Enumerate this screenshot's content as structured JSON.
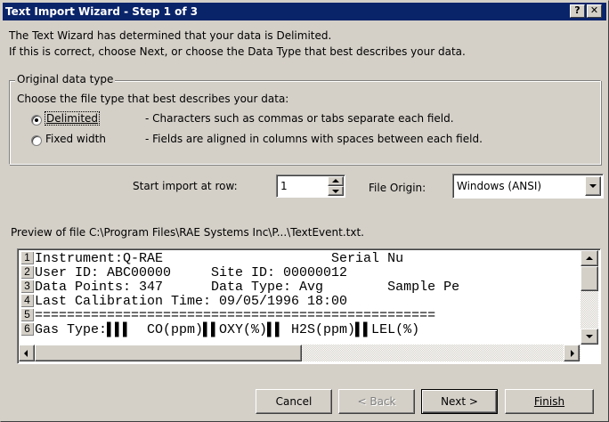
{
  "window": {
    "title": "Text Import Wizard - Step 1 of 3",
    "help_button": "?",
    "close_button": "✕"
  },
  "intro": {
    "line1": "The Text Wizard has determined that your data is Delimited.",
    "line2": "If this is correct, choose Next, or choose the Data Type that best describes your data."
  },
  "original_type": {
    "group_label": "Original data type",
    "prompt": "Choose the file type that best describes your data:",
    "options": [
      {
        "label": "Delimited",
        "description": "- Characters such as commas or tabs separate each field.",
        "checked": true
      },
      {
        "label": "Fixed width",
        "description": "- Fields are aligned in columns with spaces between each field.",
        "checked": false
      }
    ]
  },
  "start_import": {
    "label": "Start import at row:",
    "value": "1"
  },
  "file_origin": {
    "label": "File Origin:",
    "value": "Windows (ANSI)"
  },
  "preview": {
    "label": "Preview of file C:\\Program Files\\RAE Systems Inc\\P...\\TextEvent.txt.",
    "lines": [
      {
        "num": "1",
        "text": "Instrument:Q-RAE                     Serial Nu"
      },
      {
        "num": "2",
        "text": "User ID: ABC00000     Site ID: 00000012"
      },
      {
        "num": "3",
        "text": "Data Points: 347      Data Type: Avg        Sample Pe"
      },
      {
        "num": "4",
        "text": "Last Calibration Time: 09/05/1996 18:00"
      },
      {
        "num": "5",
        "text": "=================================================="
      },
      {
        "num": "6",
        "text": "Gas Type:▌▌▌  CO(ppm)▌▌OXY(%)▌▌ H2S(ppm)▌▌LEL(%)"
      }
    ]
  },
  "buttons": {
    "cancel": "Cancel",
    "back": "< Back",
    "next": "Next >",
    "finish": "Finish"
  }
}
